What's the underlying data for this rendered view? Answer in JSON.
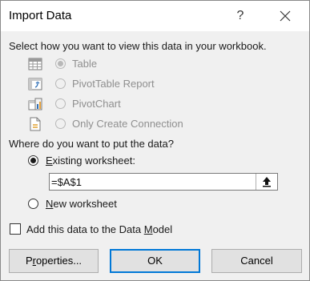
{
  "dialog": {
    "title": "Import Data",
    "help_glyph": "?",
    "close_icon": "close-icon"
  },
  "view_section": {
    "heading": "Select how you want to view this data in your workbook.",
    "options": [
      {
        "label": "Table",
        "selected": true,
        "enabled": false,
        "icon": "table-icon"
      },
      {
        "label": "PivotTable Report",
        "selected": false,
        "enabled": false,
        "icon": "pivottable-icon"
      },
      {
        "label": "PivotChart",
        "selected": false,
        "enabled": false,
        "icon": "pivotchart-icon"
      },
      {
        "label": "Only Create Connection",
        "selected": false,
        "enabled": false,
        "icon": "connection-icon"
      }
    ]
  },
  "location_section": {
    "heading": "Where do you want to put the data?",
    "existing": {
      "mnemonic": "E",
      "rest": "xisting worksheet:",
      "selected": true
    },
    "new": {
      "mnemonic": "N",
      "rest": "ew worksheet",
      "selected": false
    },
    "reference_value": "=$A$1",
    "collapse_icon": "collapse-arrow-icon"
  },
  "data_model": {
    "before": "Add this data to the Data ",
    "mnemonic": "M",
    "after": "odel",
    "checked": false
  },
  "buttons": {
    "properties": {
      "before": "P",
      "mnemonic": "r",
      "after": "operties..."
    },
    "ok": "OK",
    "cancel": "Cancel"
  },
  "colors": {
    "accent": "#0078d7",
    "body_bg": "#f0f0f0",
    "disabled_text": "#8f8f8f"
  }
}
